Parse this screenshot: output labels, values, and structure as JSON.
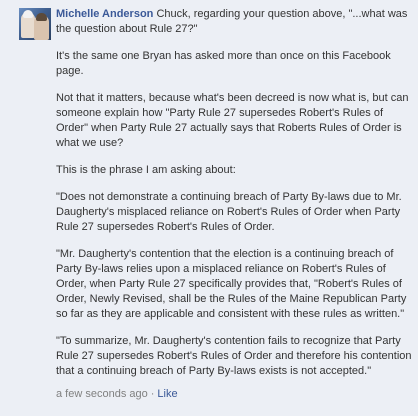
{
  "comment": {
    "author": "Michelle Anderson",
    "paragraphs": [
      "Chuck, regarding your question above, \"...what was the question about Rule 27?\"",
      "It's the same one Bryan has asked more than once on this Facebook page.",
      "Not that it matters, because what's been decreed is now what is, but can someone explain how \"Party Rule 27 supersedes Robert's Rules of Order\" when Party Rule 27 actually says that Roberts Rules of Order is what we use?",
      "This is the phrase I am asking about:",
      "\"Does not demonstrate a continuing breach of Party By-laws due to Mr. Daugherty's misplaced reliance on Robert's Rules of Order when Party Rule 27 supersedes Robert's Rules of Order.",
      "\"Mr. Daugherty's contention that the election is a continuing breach of Party By-laws relies upon a misplaced reliance on Robert's Rules of Order, when Party Rule 27 specifically provides that, \"Robert's Rules of Order, Newly Revised, shall be the Rules of the Maine Republican Party so far as they are applicable and consistent with these rules as written.\"",
      "\"To summarize, Mr. Daugherty's contention fails to recognize that Party Rule 27 supersedes Robert's Rules of Order and therefore his contention that a continuing breach of Party By-laws exists is not accepted.\""
    ],
    "timestamp": "a few seconds ago",
    "separator": "·",
    "like_label": "Like"
  },
  "colors": {
    "background": "#eceff5",
    "link": "#3b5998",
    "text": "#333333",
    "meta": "#808080"
  }
}
